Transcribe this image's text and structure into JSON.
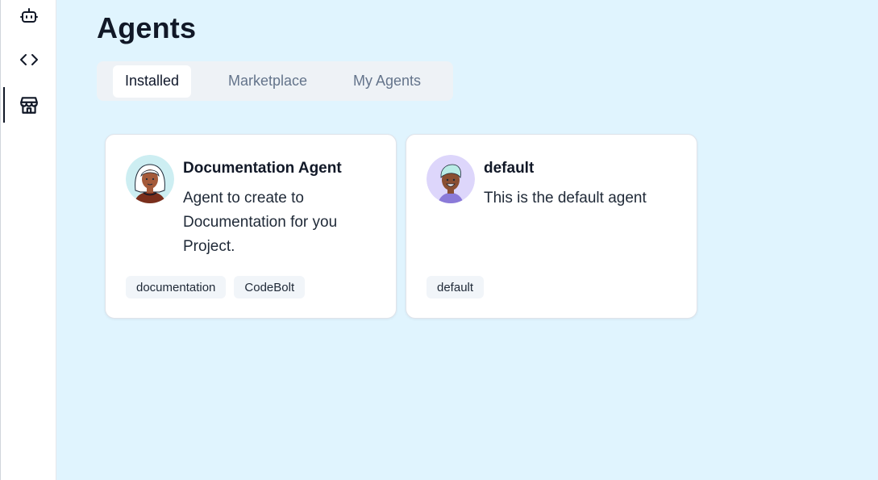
{
  "sidebar": {
    "items": [
      {
        "icon": "robot-icon",
        "active": false
      },
      {
        "icon": "code-icon",
        "active": false
      },
      {
        "icon": "store-icon",
        "active": true
      }
    ]
  },
  "page": {
    "title": "Agents"
  },
  "tabs": [
    {
      "label": "Installed",
      "active": true
    },
    {
      "label": "Marketplace",
      "active": false
    },
    {
      "label": "My Agents",
      "active": false
    }
  ],
  "agents": [
    {
      "name": "Documentation Agent",
      "description": "Agent to create to Documentation for you Project.",
      "tags": [
        "documentation",
        "CodeBolt"
      ]
    },
    {
      "name": "default",
      "description": "This is the default agent",
      "tags": [
        "default"
      ]
    }
  ],
  "colors": {
    "background": "#e0f4fe",
    "card": "#ffffff",
    "tab_bg": "#eef2f6",
    "tag_bg": "#f1f5f9"
  }
}
